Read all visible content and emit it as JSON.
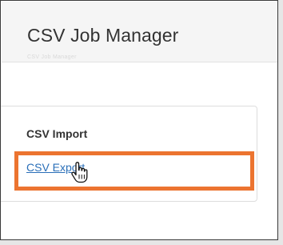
{
  "header": {
    "title": "CSV Job Manager",
    "ghost_text": "CSV Job Manager"
  },
  "menu": {
    "items": [
      {
        "label": "CSV Import"
      },
      {
        "label": "CSV Export"
      }
    ]
  },
  "colors": {
    "highlight": "#ec7430",
    "link": "#2a6fb8",
    "header_bg": "#f5f5f5"
  },
  "cursor": {
    "type": "hand-pointer-icon"
  }
}
